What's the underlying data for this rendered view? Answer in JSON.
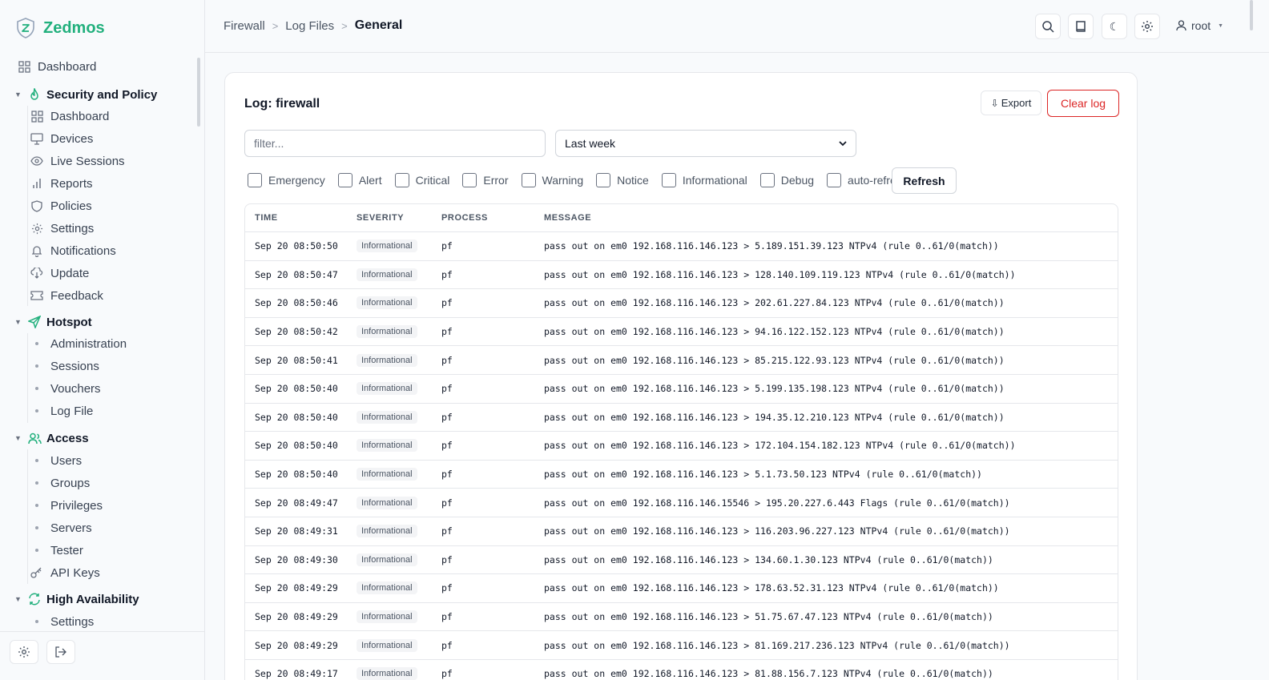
{
  "brand": {
    "name": "Zedmos"
  },
  "sidebar": {
    "top_item": "Dashboard",
    "groups": [
      {
        "label": "Security and Policy",
        "icon": "flame-icon",
        "items": [
          {
            "label": "Dashboard",
            "icon": "grid-icon"
          },
          {
            "label": "Devices",
            "icon": "monitor-icon"
          },
          {
            "label": "Live Sessions",
            "icon": "eye-icon"
          },
          {
            "label": "Reports",
            "icon": "bar-chart-icon"
          },
          {
            "label": "Policies",
            "icon": "shield-icon"
          },
          {
            "label": "Settings",
            "icon": "gear-icon"
          },
          {
            "label": "Notifications",
            "icon": "bell-icon"
          },
          {
            "label": "Update",
            "icon": "cloud-download-icon"
          },
          {
            "label": "Feedback",
            "icon": "ticket-icon"
          }
        ]
      },
      {
        "label": "Hotspot",
        "icon": "send-icon",
        "items": [
          {
            "label": "Administration"
          },
          {
            "label": "Sessions"
          },
          {
            "label": "Vouchers"
          },
          {
            "label": "Log File"
          }
        ]
      },
      {
        "label": "Access",
        "icon": "users-icon",
        "items": [
          {
            "label": "Users"
          },
          {
            "label": "Groups"
          },
          {
            "label": "Privileges"
          },
          {
            "label": "Servers"
          },
          {
            "label": "Tester"
          },
          {
            "label": "API Keys",
            "icon": "key-icon"
          }
        ]
      },
      {
        "label": "High Availability",
        "icon": "refresh-icon",
        "items": [
          {
            "label": "Settings"
          }
        ]
      }
    ]
  },
  "breadcrumb": [
    "Firewall",
    "Log Files",
    "General"
  ],
  "header": {
    "user": "root"
  },
  "log": {
    "title": "Log: firewall",
    "export_label": "Export",
    "clear_label": "Clear log",
    "filter_placeholder": "filter...",
    "filter_value": "",
    "range_selected": "Last week",
    "checkboxes": [
      "Emergency",
      "Alert",
      "Critical",
      "Error",
      "Warning",
      "Notice",
      "Informational",
      "Debug",
      "auto-refresh"
    ],
    "refresh_label": "Refresh",
    "columns": [
      "TIME",
      "SEVERITY",
      "PROCESS",
      "MESSAGE"
    ],
    "rows": [
      {
        "time": "Sep 20 08:50:50",
        "severity": "Informational",
        "process": "pf",
        "message": "pass out on em0 192.168.116.146.123 > 5.189.151.39.123 NTPv4 (rule 0..61/0(match))"
      },
      {
        "time": "Sep 20 08:50:47",
        "severity": "Informational",
        "process": "pf",
        "message": "pass out on em0 192.168.116.146.123 > 128.140.109.119.123 NTPv4 (rule 0..61/0(match))"
      },
      {
        "time": "Sep 20 08:50:46",
        "severity": "Informational",
        "process": "pf",
        "message": "pass out on em0 192.168.116.146.123 > 202.61.227.84.123 NTPv4 (rule 0..61/0(match))"
      },
      {
        "time": "Sep 20 08:50:42",
        "severity": "Informational",
        "process": "pf",
        "message": "pass out on em0 192.168.116.146.123 > 94.16.122.152.123 NTPv4 (rule 0..61/0(match))"
      },
      {
        "time": "Sep 20 08:50:41",
        "severity": "Informational",
        "process": "pf",
        "message": "pass out on em0 192.168.116.146.123 > 85.215.122.93.123 NTPv4 (rule 0..61/0(match))"
      },
      {
        "time": "Sep 20 08:50:40",
        "severity": "Informational",
        "process": "pf",
        "message": "pass out on em0 192.168.116.146.123 > 5.199.135.198.123 NTPv4 (rule 0..61/0(match))"
      },
      {
        "time": "Sep 20 08:50:40",
        "severity": "Informational",
        "process": "pf",
        "message": "pass out on em0 192.168.116.146.123 > 194.35.12.210.123 NTPv4 (rule 0..61/0(match))"
      },
      {
        "time": "Sep 20 08:50:40",
        "severity": "Informational",
        "process": "pf",
        "message": "pass out on em0 192.168.116.146.123 > 172.104.154.182.123 NTPv4 (rule 0..61/0(match))"
      },
      {
        "time": "Sep 20 08:50:40",
        "severity": "Informational",
        "process": "pf",
        "message": "pass out on em0 192.168.116.146.123 > 5.1.73.50.123 NTPv4 (rule 0..61/0(match))"
      },
      {
        "time": "Sep 20 08:49:47",
        "severity": "Informational",
        "process": "pf",
        "message": "pass out on em0 192.168.116.146.15546 > 195.20.227.6.443 Flags (rule 0..61/0(match))"
      },
      {
        "time": "Sep 20 08:49:31",
        "severity": "Informational",
        "process": "pf",
        "message": "pass out on em0 192.168.116.146.123 > 116.203.96.227.123 NTPv4 (rule 0..61/0(match))"
      },
      {
        "time": "Sep 20 08:49:30",
        "severity": "Informational",
        "process": "pf",
        "message": "pass out on em0 192.168.116.146.123 > 134.60.1.30.123 NTPv4 (rule 0..61/0(match))"
      },
      {
        "time": "Sep 20 08:49:29",
        "severity": "Informational",
        "process": "pf",
        "message": "pass out on em0 192.168.116.146.123 > 178.63.52.31.123 NTPv4 (rule 0..61/0(match))"
      },
      {
        "time": "Sep 20 08:49:29",
        "severity": "Informational",
        "process": "pf",
        "message": "pass out on em0 192.168.116.146.123 > 51.75.67.47.123 NTPv4 (rule 0..61/0(match))"
      },
      {
        "time": "Sep 20 08:49:29",
        "severity": "Informational",
        "process": "pf",
        "message": "pass out on em0 192.168.116.146.123 > 81.169.217.236.123 NTPv4 (rule 0..61/0(match))"
      },
      {
        "time": "Sep 20 08:49:17",
        "severity": "Informational",
        "process": "pf",
        "message": "pass out on em0 192.168.116.146.123 > 81.88.156.7.123 NTPv4 (rule 0..61/0(match))"
      }
    ]
  },
  "colors": {
    "brand": "#22b07d",
    "danger": "#dc2626"
  }
}
